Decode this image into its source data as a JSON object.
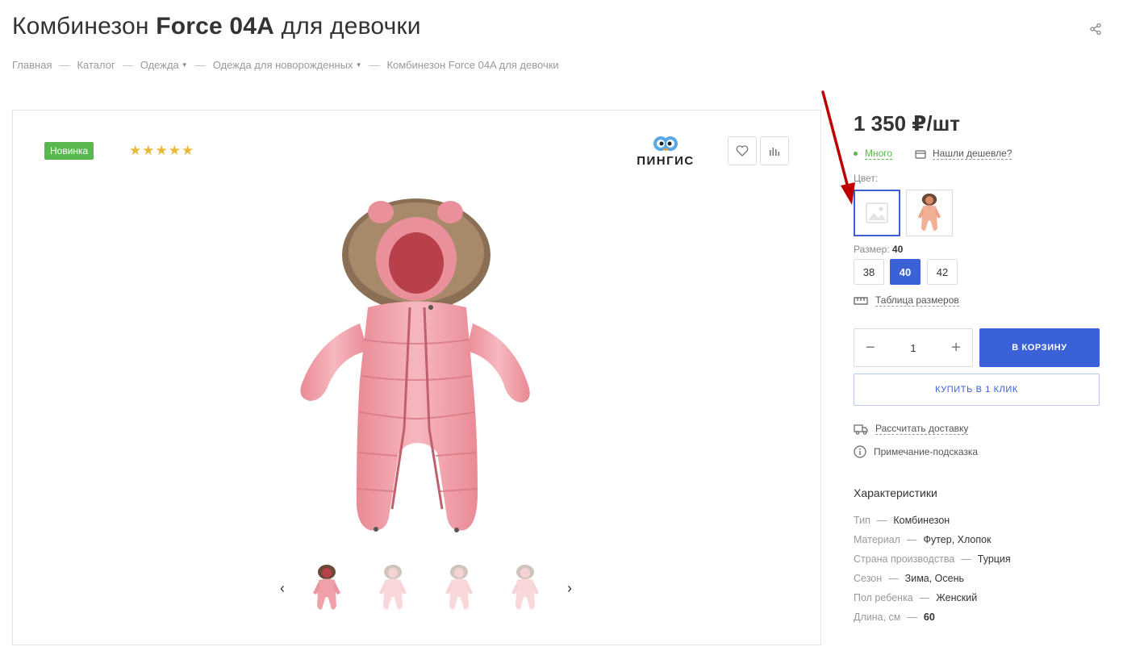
{
  "title": {
    "pre": "Комбинезон ",
    "bold": "Force 04A",
    "post": " для девочки"
  },
  "breadcrumbs": [
    {
      "label": "Главная",
      "dropdown": false
    },
    {
      "label": "Каталог",
      "dropdown": false
    },
    {
      "label": "Одежда",
      "dropdown": true
    },
    {
      "label": "Одежда для новорожденных",
      "dropdown": true
    },
    {
      "label": "Комбинезон Force 04A для девочки",
      "dropdown": false
    }
  ],
  "gallery": {
    "badge": "Новинка",
    "stars": "★★★★★",
    "rating": 5,
    "brand": "ПИНГИС",
    "thumbnails_count": 4,
    "active_thumbnail": 1
  },
  "product": {
    "price": "1 350 ₽/шт",
    "stock": "Много",
    "cheaper_link": "Нашли дешевле?",
    "color_label": "Цвет:",
    "size_label": "Размер:",
    "size_selected": "40",
    "sizes": [
      "38",
      "40",
      "42"
    ],
    "size_table_link": "Таблица размеров",
    "quantity": "1",
    "add_to_cart": "В КОРЗИНУ",
    "buy_one_click": "КУПИТЬ В 1 КЛИК",
    "delivery_link": "Рассчитать доставку",
    "hint": "Примечание-подсказка"
  },
  "characteristics": {
    "heading": "Характеристики",
    "rows": [
      {
        "key": "Тип",
        "value": "Комбинезон"
      },
      {
        "key": "Материал",
        "value": "Футер, Хлопок"
      },
      {
        "key": "Страна производства",
        "value": "Турция"
      },
      {
        "key": "Сезон",
        "value": "Зима, Осень"
      },
      {
        "key": "Пол ребенка",
        "value": "Женский"
      },
      {
        "key": "Длина, см",
        "value": "60"
      }
    ]
  },
  "colors": {
    "accent": "#3a61d5",
    "badge_green": "#59b84d",
    "stars": "#e8b93a",
    "annotation_red": "#c00000",
    "suit_pink": "#f0a0a8"
  }
}
